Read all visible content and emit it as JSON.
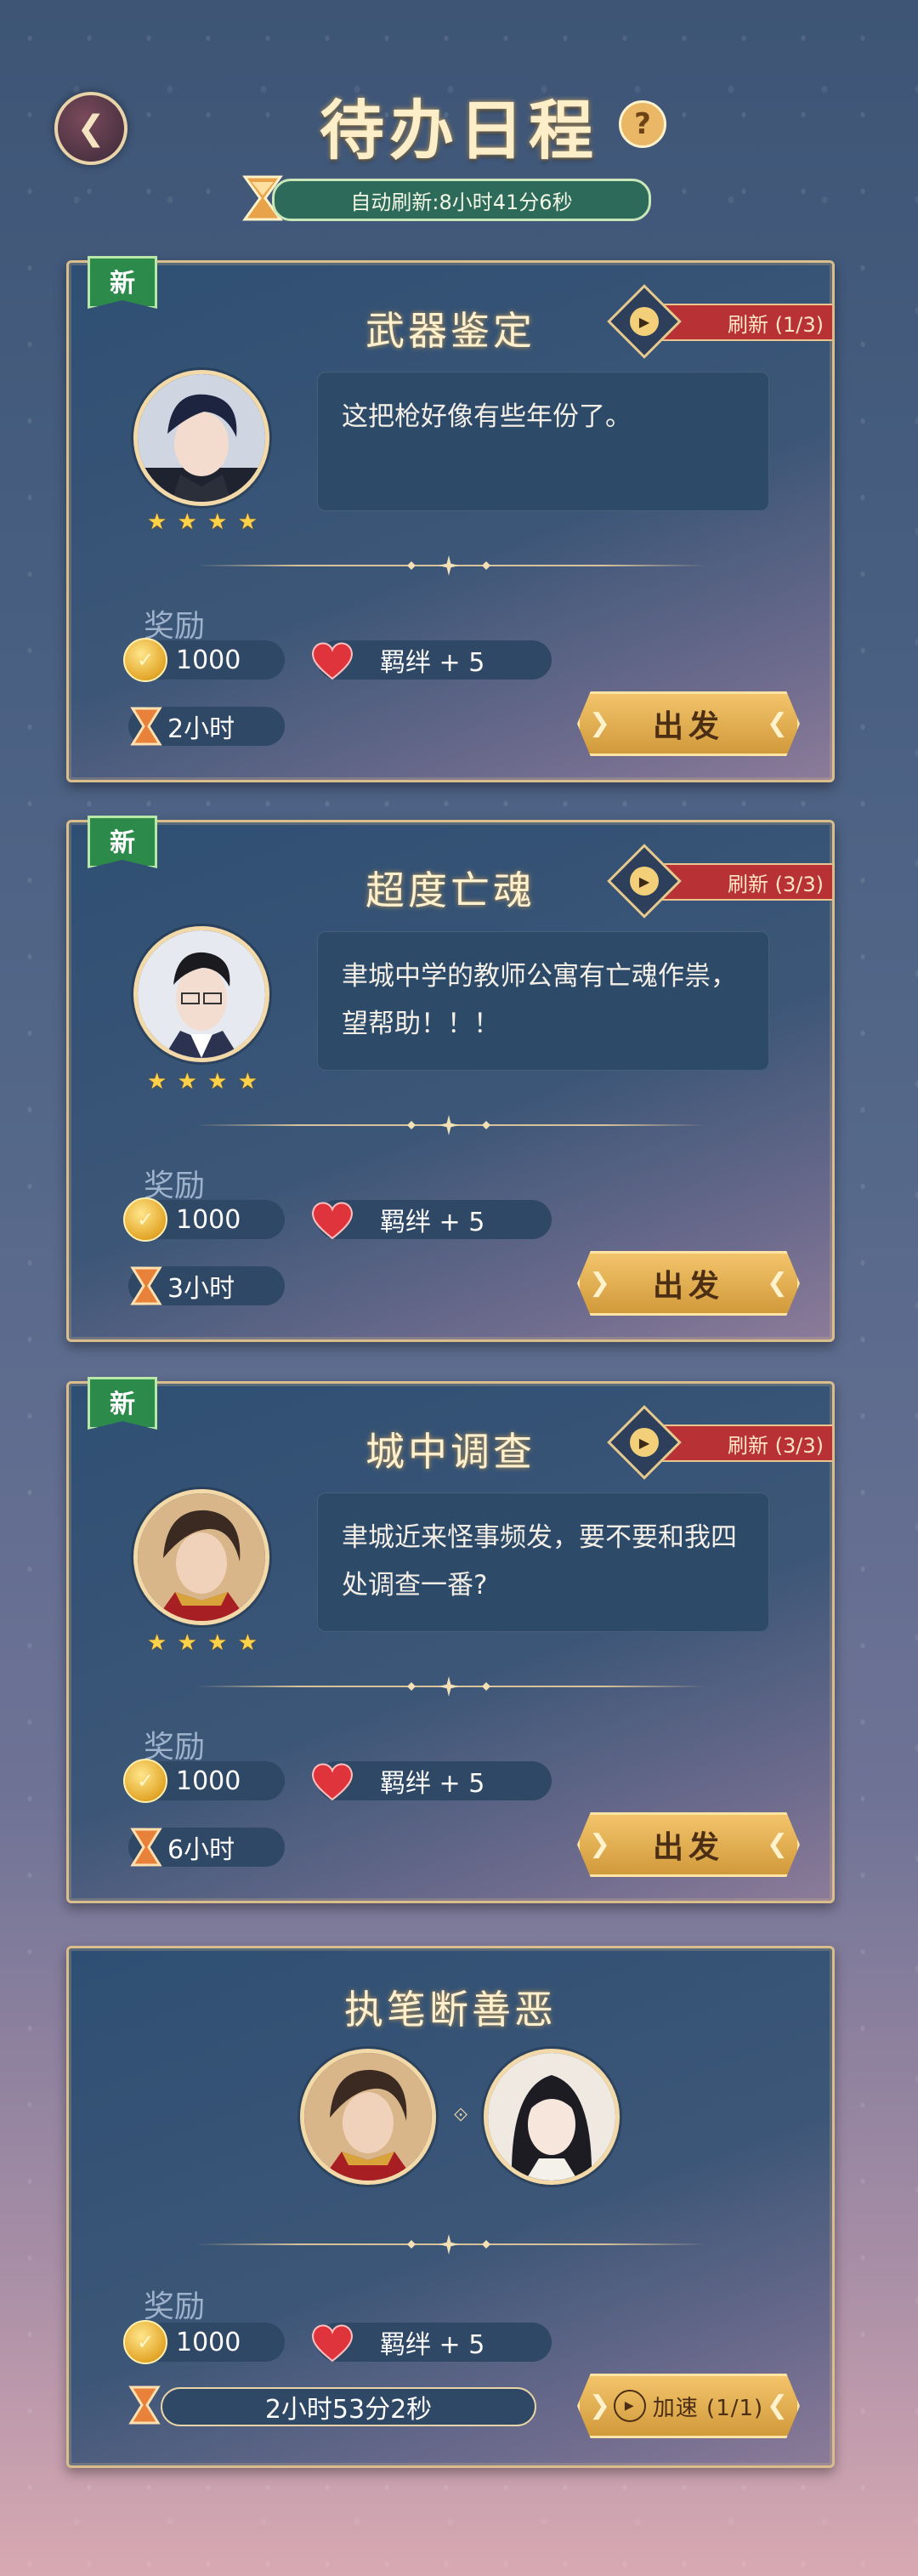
{
  "header": {
    "back_icon": "back-arrow-icon",
    "title": "待办日程",
    "help_label": "?",
    "auto_refresh": "自动刷新:8小时41分6秒"
  },
  "tasks": [
    {
      "badge": "新",
      "title": "武器鉴定",
      "refresh": "刷新 (1/3)",
      "message": "这把枪好像有些年份了。",
      "stars": 4,
      "reward_label": "奖励",
      "coins": "1000",
      "bond": "羁绊 + 5",
      "duration": "2小时",
      "action": "出发"
    },
    {
      "badge": "新",
      "title": "超度亡魂",
      "refresh": "刷新 (3/3)",
      "message": "聿城中学的教师公寓有亡魂作祟，望帮助！！！",
      "stars": 4,
      "reward_label": "奖励",
      "coins": "1000",
      "bond": "羁绊 + 5",
      "duration": "3小时",
      "action": "出发"
    },
    {
      "badge": "新",
      "title": "城中调查",
      "refresh": "刷新 (3/3)",
      "message": "聿城近来怪事频发，要不要和我四处调查一番?",
      "stars": 4,
      "reward_label": "奖励",
      "coins": "1000",
      "bond": "羁绊 + 5",
      "duration": "6小时",
      "action": "出发"
    }
  ],
  "active_task": {
    "title": "执笔断善恶",
    "reward_label": "奖励",
    "coins": "1000",
    "bond": "羁绊 + 5",
    "timer": "2小时53分2秒",
    "action": "加速 (1/1)"
  },
  "colors": {
    "gold": "#f2d9a7",
    "new_badge": "#2c8a4a",
    "refresh_tag": "#b73135",
    "button": "#e0ac52"
  }
}
